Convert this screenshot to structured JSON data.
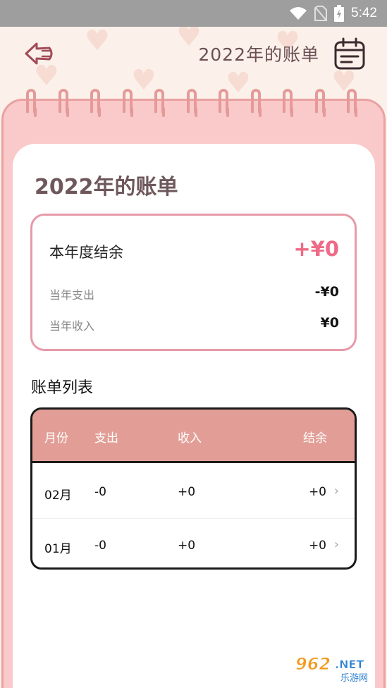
{
  "status_bar": {
    "time": "5:42"
  },
  "header": {
    "title": "2022年的账单"
  },
  "card": {
    "title": "2022年的账单"
  },
  "summary": {
    "balance_label": "本年度结余",
    "balance_value": "+¥0",
    "expense_label": "当年支出",
    "expense_value": "-¥0",
    "income_label": "当年收入",
    "income_value": "¥0"
  },
  "list": {
    "title": "账单列表",
    "headers": {
      "month": "月份",
      "expense": "支出",
      "income": "收入",
      "balance": "结余"
    },
    "rows": [
      {
        "month": "02月",
        "expense": "-0",
        "income": "+0",
        "balance": "+0"
      },
      {
        "month": "01月",
        "expense": "-0",
        "income": "+0",
        "balance": "+0"
      }
    ]
  },
  "watermark": {
    "brand": "962.NET",
    "sub": "乐游网"
  },
  "colors": {
    "accent_pink": "#ee6a86",
    "header_row": "#e29e96",
    "notebook": "#fac9c9",
    "title_brown": "#6e585c"
  },
  "icons": {
    "back": "back-arrow-icon",
    "calendar": "calendar-icon",
    "chevron": "chevron-right-icon"
  }
}
